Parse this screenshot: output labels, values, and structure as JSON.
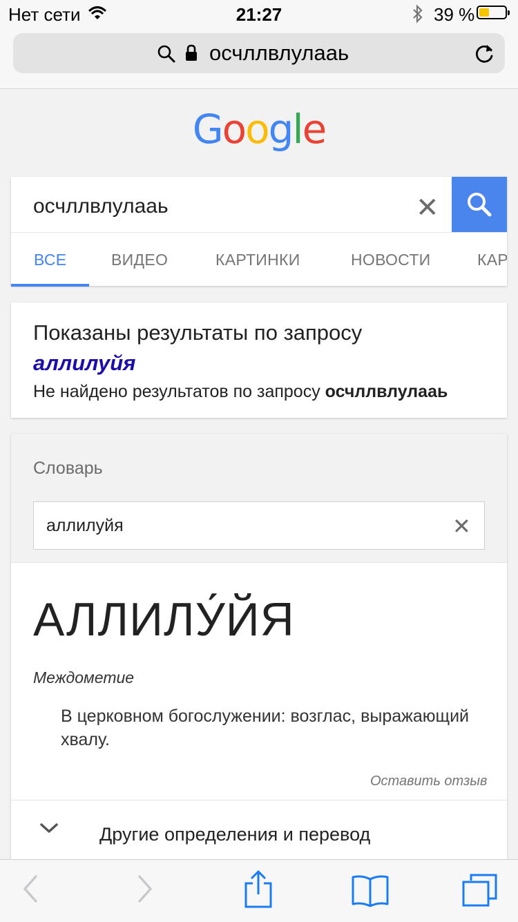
{
  "status_bar": {
    "carrier": "Нет сети",
    "time": "21:27",
    "battery_percent": "39 %",
    "battery_level": 0.39
  },
  "browser": {
    "url_text": "осчллвлулааь"
  },
  "logo": {
    "letters": [
      "G",
      "o",
      "o",
      "g",
      "l",
      "e"
    ],
    "colors": [
      "#4285F4",
      "#EA4335",
      "#FBBC05",
      "#4285F4",
      "#34A853",
      "#EA4335"
    ]
  },
  "search": {
    "query": "осчллвлулааь",
    "clear_symbol": "✕",
    "accent": "#4A84ED"
  },
  "tabs": [
    {
      "label": "ВСЕ",
      "active": true
    },
    {
      "label": "ВИДЕО",
      "active": false
    },
    {
      "label": "КАРТИНКИ",
      "active": false
    },
    {
      "label": "НОВОСТИ",
      "active": false
    },
    {
      "label": "КАР",
      "active": false
    }
  ],
  "spelling": {
    "showing_label": "Показаны результаты по запросу",
    "corrected_query": "аллилуйя",
    "no_results_label": "Не найдено результатов по запросу",
    "original_query": "осчллвлулааь"
  },
  "dictionary": {
    "section_label": "Словарь",
    "input_value": "аллилуйя",
    "clear_symbol": "✕",
    "headword": "АЛЛИЛУ́ЙЯ",
    "part_of_speech": "Междометие",
    "definition": "В церковном богослужении: возглас, выражающий хвалу.",
    "feedback_link": "Оставить отзыв",
    "more_label": "Другие определения и перевод"
  },
  "toolbar": {
    "icons": [
      "back-icon",
      "forward-icon",
      "share-icon",
      "bookmarks-icon",
      "tabs-icon"
    ]
  }
}
